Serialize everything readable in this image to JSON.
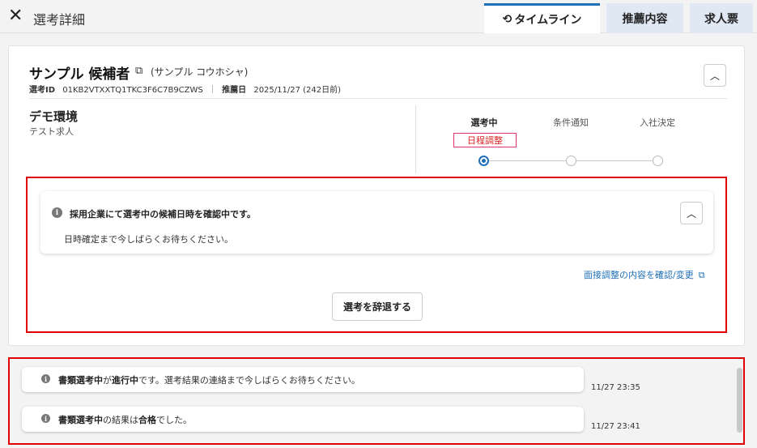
{
  "header": {
    "close_icon": "close-icon",
    "title": "選考詳細",
    "tabs": [
      {
        "label": "タイムライン",
        "icon": "history-icon",
        "active": true
      },
      {
        "label": "推薦内容",
        "active": false
      },
      {
        "label": "求人票",
        "active": false
      }
    ]
  },
  "candidate": {
    "name": "サンプル 候補者",
    "kana": "(サンプル コウホシャ)",
    "selection_id_label": "選考ID",
    "selection_id": "01KB2VTXXTQ1TKC3F6C7B9CZWS",
    "recommend_date_label": "推薦日",
    "recommend_date": "2025/11/27 (242日前)"
  },
  "job": {
    "company": "デモ環境",
    "title": "テスト求人"
  },
  "progress": {
    "steps": [
      "選考中",
      "条件通知",
      "入社決定"
    ],
    "current_step": 0,
    "badge": "日程調整"
  },
  "notice": {
    "title": "採用企業にて選考中の候補日時を確認中です。",
    "body": "日時確定まで今しばらくお待ちください。",
    "link": "面接調整の内容を確認/変更",
    "withdraw_button": "選考を辞退する"
  },
  "timeline": [
    {
      "bold1": "書類選考中",
      "text1": "が",
      "bold2": "進行中",
      "text2": "です。選考結果の連絡まで今しばらくお待ちください。",
      "time": "11/27 23:35"
    },
    {
      "bold1": "書類選考中",
      "text1": "の結果は",
      "bold2": "合格",
      "text2": "でした。",
      "time": "11/27 23:41"
    }
  ],
  "colors": {
    "accent": "#1e6fb8",
    "badge": "#e0336a",
    "highlight": "#e00000",
    "tab_inactive": "#dfe8f3"
  }
}
